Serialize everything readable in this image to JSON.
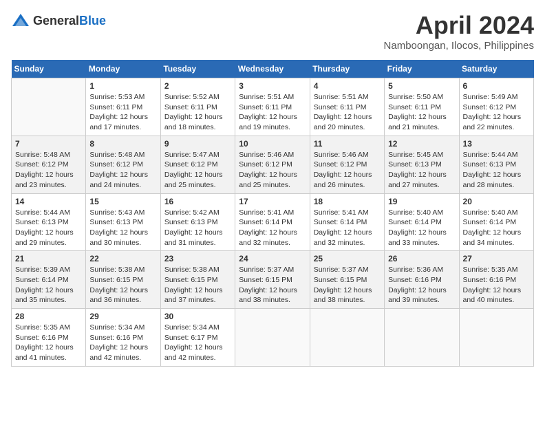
{
  "header": {
    "logo_general": "General",
    "logo_blue": "Blue",
    "month_title": "April 2024",
    "location": "Namboongan, Ilocos, Philippines"
  },
  "weekdays": [
    "Sunday",
    "Monday",
    "Tuesday",
    "Wednesday",
    "Thursday",
    "Friday",
    "Saturday"
  ],
  "weeks": [
    [
      {
        "day": "",
        "sunrise": "",
        "sunset": "",
        "daylight": ""
      },
      {
        "day": "1",
        "sunrise": "Sunrise: 5:53 AM",
        "sunset": "Sunset: 6:11 PM",
        "daylight": "Daylight: 12 hours and 17 minutes."
      },
      {
        "day": "2",
        "sunrise": "Sunrise: 5:52 AM",
        "sunset": "Sunset: 6:11 PM",
        "daylight": "Daylight: 12 hours and 18 minutes."
      },
      {
        "day": "3",
        "sunrise": "Sunrise: 5:51 AM",
        "sunset": "Sunset: 6:11 PM",
        "daylight": "Daylight: 12 hours and 19 minutes."
      },
      {
        "day": "4",
        "sunrise": "Sunrise: 5:51 AM",
        "sunset": "Sunset: 6:11 PM",
        "daylight": "Daylight: 12 hours and 20 minutes."
      },
      {
        "day": "5",
        "sunrise": "Sunrise: 5:50 AM",
        "sunset": "Sunset: 6:11 PM",
        "daylight": "Daylight: 12 hours and 21 minutes."
      },
      {
        "day": "6",
        "sunrise": "Sunrise: 5:49 AM",
        "sunset": "Sunset: 6:12 PM",
        "daylight": "Daylight: 12 hours and 22 minutes."
      }
    ],
    [
      {
        "day": "7",
        "sunrise": "Sunrise: 5:48 AM",
        "sunset": "Sunset: 6:12 PM",
        "daylight": "Daylight: 12 hours and 23 minutes."
      },
      {
        "day": "8",
        "sunrise": "Sunrise: 5:48 AM",
        "sunset": "Sunset: 6:12 PM",
        "daylight": "Daylight: 12 hours and 24 minutes."
      },
      {
        "day": "9",
        "sunrise": "Sunrise: 5:47 AM",
        "sunset": "Sunset: 6:12 PM",
        "daylight": "Daylight: 12 hours and 25 minutes."
      },
      {
        "day": "10",
        "sunrise": "Sunrise: 5:46 AM",
        "sunset": "Sunset: 6:12 PM",
        "daylight": "Daylight: 12 hours and 25 minutes."
      },
      {
        "day": "11",
        "sunrise": "Sunrise: 5:46 AM",
        "sunset": "Sunset: 6:12 PM",
        "daylight": "Daylight: 12 hours and 26 minutes."
      },
      {
        "day": "12",
        "sunrise": "Sunrise: 5:45 AM",
        "sunset": "Sunset: 6:13 PM",
        "daylight": "Daylight: 12 hours and 27 minutes."
      },
      {
        "day": "13",
        "sunrise": "Sunrise: 5:44 AM",
        "sunset": "Sunset: 6:13 PM",
        "daylight": "Daylight: 12 hours and 28 minutes."
      }
    ],
    [
      {
        "day": "14",
        "sunrise": "Sunrise: 5:44 AM",
        "sunset": "Sunset: 6:13 PM",
        "daylight": "Daylight: 12 hours and 29 minutes."
      },
      {
        "day": "15",
        "sunrise": "Sunrise: 5:43 AM",
        "sunset": "Sunset: 6:13 PM",
        "daylight": "Daylight: 12 hours and 30 minutes."
      },
      {
        "day": "16",
        "sunrise": "Sunrise: 5:42 AM",
        "sunset": "Sunset: 6:13 PM",
        "daylight": "Daylight: 12 hours and 31 minutes."
      },
      {
        "day": "17",
        "sunrise": "Sunrise: 5:41 AM",
        "sunset": "Sunset: 6:14 PM",
        "daylight": "Daylight: 12 hours and 32 minutes."
      },
      {
        "day": "18",
        "sunrise": "Sunrise: 5:41 AM",
        "sunset": "Sunset: 6:14 PM",
        "daylight": "Daylight: 12 hours and 32 minutes."
      },
      {
        "day": "19",
        "sunrise": "Sunrise: 5:40 AM",
        "sunset": "Sunset: 6:14 PM",
        "daylight": "Daylight: 12 hours and 33 minutes."
      },
      {
        "day": "20",
        "sunrise": "Sunrise: 5:40 AM",
        "sunset": "Sunset: 6:14 PM",
        "daylight": "Daylight: 12 hours and 34 minutes."
      }
    ],
    [
      {
        "day": "21",
        "sunrise": "Sunrise: 5:39 AM",
        "sunset": "Sunset: 6:14 PM",
        "daylight": "Daylight: 12 hours and 35 minutes."
      },
      {
        "day": "22",
        "sunrise": "Sunrise: 5:38 AM",
        "sunset": "Sunset: 6:15 PM",
        "daylight": "Daylight: 12 hours and 36 minutes."
      },
      {
        "day": "23",
        "sunrise": "Sunrise: 5:38 AM",
        "sunset": "Sunset: 6:15 PM",
        "daylight": "Daylight: 12 hours and 37 minutes."
      },
      {
        "day": "24",
        "sunrise": "Sunrise: 5:37 AM",
        "sunset": "Sunset: 6:15 PM",
        "daylight": "Daylight: 12 hours and 38 minutes."
      },
      {
        "day": "25",
        "sunrise": "Sunrise: 5:37 AM",
        "sunset": "Sunset: 6:15 PM",
        "daylight": "Daylight: 12 hours and 38 minutes."
      },
      {
        "day": "26",
        "sunrise": "Sunrise: 5:36 AM",
        "sunset": "Sunset: 6:16 PM",
        "daylight": "Daylight: 12 hours and 39 minutes."
      },
      {
        "day": "27",
        "sunrise": "Sunrise: 5:35 AM",
        "sunset": "Sunset: 6:16 PM",
        "daylight": "Daylight: 12 hours and 40 minutes."
      }
    ],
    [
      {
        "day": "28",
        "sunrise": "Sunrise: 5:35 AM",
        "sunset": "Sunset: 6:16 PM",
        "daylight": "Daylight: 12 hours and 41 minutes."
      },
      {
        "day": "29",
        "sunrise": "Sunrise: 5:34 AM",
        "sunset": "Sunset: 6:16 PM",
        "daylight": "Daylight: 12 hours and 42 minutes."
      },
      {
        "day": "30",
        "sunrise": "Sunrise: 5:34 AM",
        "sunset": "Sunset: 6:17 PM",
        "daylight": "Daylight: 12 hours and 42 minutes."
      },
      {
        "day": "",
        "sunrise": "",
        "sunset": "",
        "daylight": ""
      },
      {
        "day": "",
        "sunrise": "",
        "sunset": "",
        "daylight": ""
      },
      {
        "day": "",
        "sunrise": "",
        "sunset": "",
        "daylight": ""
      },
      {
        "day": "",
        "sunrise": "",
        "sunset": "",
        "daylight": ""
      }
    ]
  ]
}
